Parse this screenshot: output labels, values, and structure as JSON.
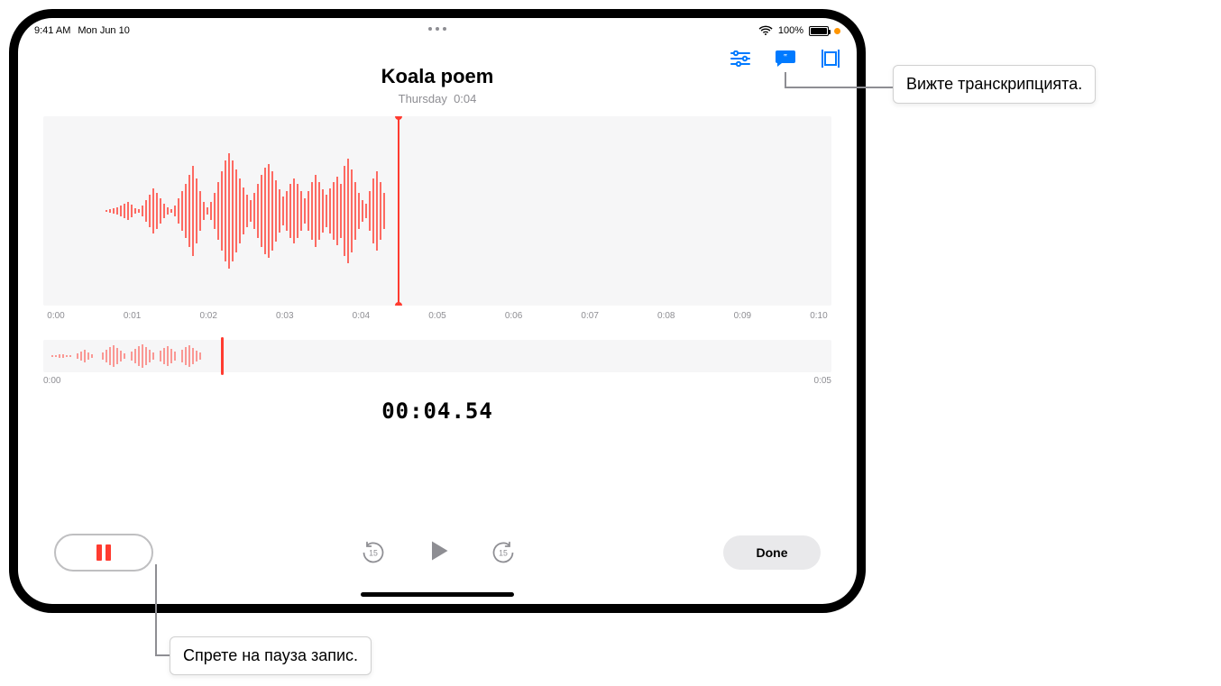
{
  "status": {
    "time": "9:41 AM",
    "date": "Mon Jun 10",
    "battery_text": "100%",
    "battery_pct": 100
  },
  "top_actions": {
    "playback_settings_icon": "playback-settings",
    "transcript_icon": "transcript",
    "trim_icon": "trim"
  },
  "recording": {
    "title": "Koala poem",
    "day": "Thursday",
    "duration_short": "0:04"
  },
  "ruler": {
    "marks": [
      "0:00",
      "0:01",
      "0:02",
      "0:03",
      "0:04",
      "0:05",
      "0:06",
      "0:07",
      "0:08",
      "0:09",
      "0:10"
    ]
  },
  "overview_ruler": {
    "start": "0:00",
    "end": "0:05"
  },
  "playhead_time": "00:04.54",
  "controls": {
    "skip_seconds_label": "15",
    "done_label": "Done"
  },
  "callouts": {
    "transcript": "Вижте транскрипцията.",
    "pause": "Спрете на пауза запис."
  }
}
